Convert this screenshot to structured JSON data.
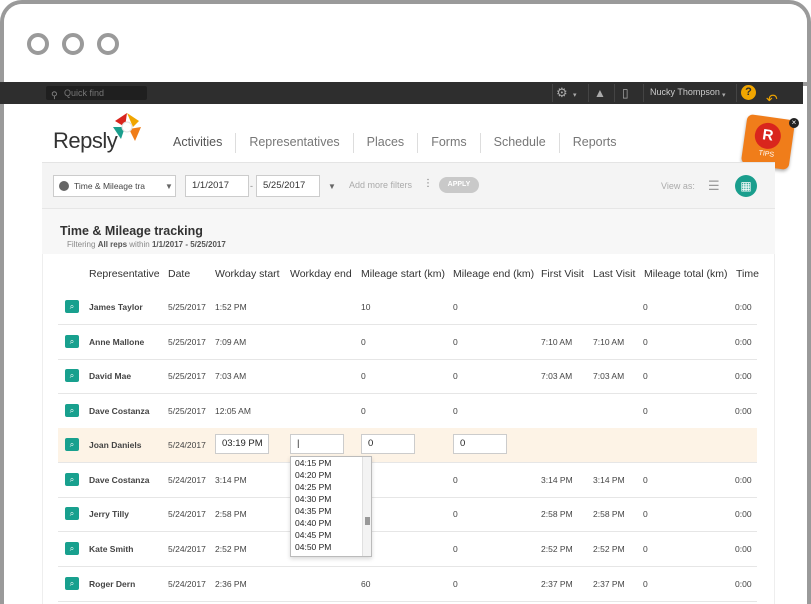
{
  "topbar": {
    "search_placeholder": "Quick find",
    "user_name": "Nucky Thompson",
    "help_label": "?"
  },
  "brand": {
    "logo_text": "Repsly"
  },
  "nav": {
    "items": [
      {
        "label": "Activities",
        "active": true
      },
      {
        "label": "Representatives"
      },
      {
        "label": "Places"
      },
      {
        "label": "Forms"
      },
      {
        "label": "Schedule"
      },
      {
        "label": "Reports"
      }
    ]
  },
  "tips": {
    "letter": "R",
    "label": "TIPS"
  },
  "filters": {
    "activity_type": "Time & Mileage tra",
    "date_from": "1/1/2017",
    "date_to": "5/25/2017",
    "add_more": "Add more filters",
    "apply": "APPLY",
    "view_as": "View as:"
  },
  "report": {
    "title": "Time & Mileage tracking",
    "subtitle_prefix": "Filtering",
    "subtitle_reps": "All reps",
    "subtitle_within": "within",
    "subtitle_range": "1/1/2017 - 5/25/2017"
  },
  "table": {
    "headers": [
      "Representative",
      "Date",
      "Workday start",
      "Workday end",
      "Mileage start (km)",
      "Mileage end (km)",
      "First Visit",
      "Last Visit",
      "Mileage total (km)",
      "Time"
    ],
    "rows": [
      {
        "rep": "James Taylor",
        "date": "5/25/2017",
        "ws": "1:52 PM",
        "we": "",
        "ms": "10",
        "me": "0",
        "fv": "",
        "lv": "",
        "mt": "0",
        "t": "0:00"
      },
      {
        "rep": "Anne Mallone",
        "date": "5/25/2017",
        "ws": "7:09 AM",
        "we": "",
        "ms": "0",
        "me": "0",
        "fv": "7:10 AM",
        "lv": "7:10 AM",
        "mt": "0",
        "t": "0:00"
      },
      {
        "rep": "David Mae",
        "date": "5/25/2017",
        "ws": "7:03 AM",
        "we": "",
        "ms": "0",
        "me": "0",
        "fv": "7:03 AM",
        "lv": "7:03 AM",
        "mt": "0",
        "t": "0:00"
      },
      {
        "rep": "Dave Costanza",
        "date": "5/25/2017",
        "ws": "12:05 AM",
        "we": "",
        "ms": "0",
        "me": "0",
        "fv": "",
        "lv": "",
        "mt": "0",
        "t": "0:00"
      },
      {
        "rep": "Joan Daniels",
        "date": "5/24/2017",
        "ws": "03:19 PM",
        "we": "|",
        "ms": "0",
        "me": "0",
        "fv": "",
        "lv": "",
        "mt": "",
        "t": ""
      },
      {
        "rep": "Dave Costanza",
        "date": "5/24/2017",
        "ws": "3:14 PM",
        "we": "",
        "ms": "1",
        "me": "0",
        "fv": "3:14 PM",
        "lv": "3:14 PM",
        "mt": "0",
        "t": "0:00"
      },
      {
        "rep": "Jerry Tilly",
        "date": "5/24/2017",
        "ws": "2:58 PM",
        "we": "",
        "ms": "",
        "me": "0",
        "fv": "2:58 PM",
        "lv": "2:58 PM",
        "mt": "0",
        "t": "0:00"
      },
      {
        "rep": "Kate Smith",
        "date": "5/24/2017",
        "ws": "2:52 PM",
        "we": "",
        "ms": "",
        "me": "0",
        "fv": "2:52 PM",
        "lv": "2:52 PM",
        "mt": "0",
        "t": "0:00"
      },
      {
        "rep": "Roger Dern",
        "date": "5/24/2017",
        "ws": "2:36 PM",
        "we": "",
        "ms": "60",
        "me": "0",
        "fv": "2:37 PM",
        "lv": "2:37 PM",
        "mt": "0",
        "t": "0:00"
      }
    ],
    "editing_row_index": 4
  },
  "time_dropdown": {
    "options": [
      "04:15 PM",
      "04:20 PM",
      "04:25 PM",
      "04:30 PM",
      "04:35 PM",
      "04:40 PM",
      "04:45 PM",
      "04:50 PM"
    ]
  },
  "colors": {
    "accent": "#1a9e8d",
    "tips": "#f07d1a",
    "active_row": "#fdf3e6"
  }
}
